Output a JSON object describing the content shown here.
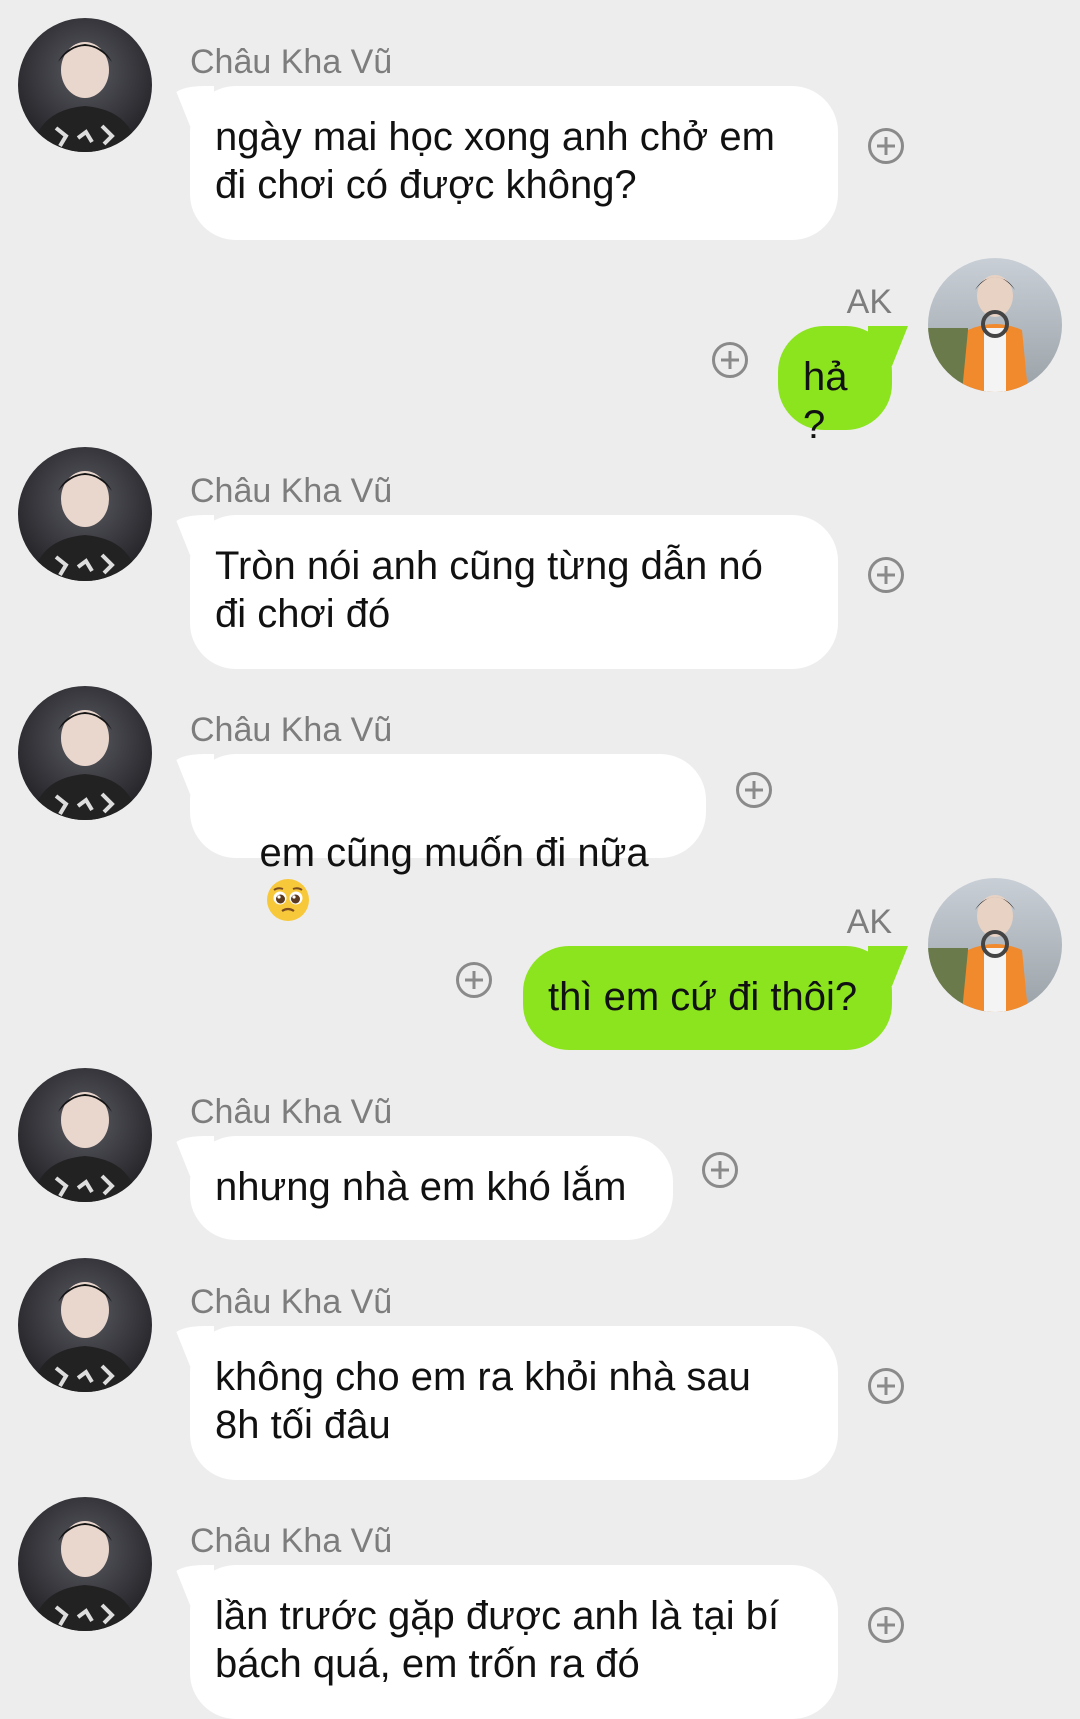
{
  "contact_name": "Châu Kha Vũ",
  "self_name": "AK",
  "colors": {
    "background": "#ededed",
    "incoming_bubble": "#ffffff",
    "outgoing_bubble": "#8be41d",
    "name_text": "#7d7d7d",
    "icon": "#8a8a8a"
  },
  "messages": [
    {
      "sender": "Châu Kha Vũ",
      "text": "ngày mai học xong anh chở em\nđi chơi có được không?"
    },
    {
      "sender": "AK",
      "text": "hả?"
    },
    {
      "sender": "Châu Kha Vũ",
      "text": "Tròn nói anh cũng từng dẫn nó\nđi chơi đó"
    },
    {
      "sender": "Châu Kha Vũ",
      "text": "em cũng muốn đi nữa",
      "emoji": "pleading-face-emoji"
    },
    {
      "sender": "AK",
      "text": "thì em cứ đi thôi?"
    },
    {
      "sender": "Châu Kha Vũ",
      "text": "nhưng nhà em khó lắm"
    },
    {
      "sender": "Châu Kha Vũ",
      "text": "không cho em ra khỏi nhà sau\n8h tối đâu"
    },
    {
      "sender": "Châu Kha Vũ",
      "text": "lần trước gặp được anh là tại bí\nbách quá, em trốn ra đó"
    }
  ],
  "icons": {
    "add": "plus-circle-icon",
    "contact_avatar": "avatar",
    "self_avatar": "avatar"
  }
}
